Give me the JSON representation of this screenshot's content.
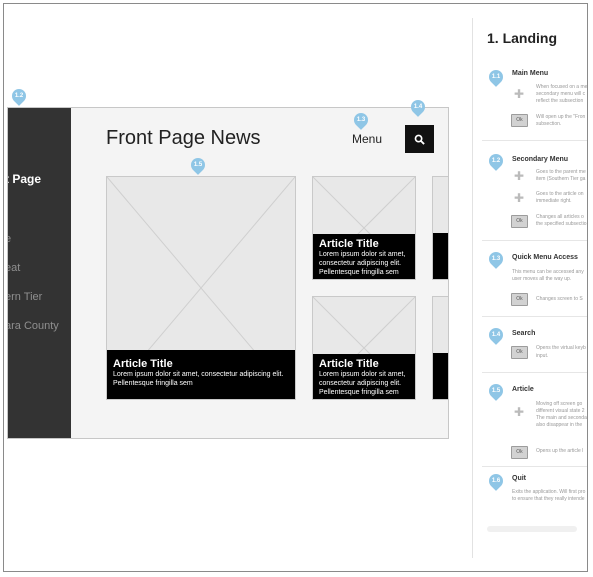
{
  "screen": {
    "title": "Front Page News",
    "menu_label": "Menu",
    "sidebar_items": [
      "t Page",
      "",
      "e",
      "eat",
      "ern Tier",
      "ara County"
    ],
    "articles": [
      {
        "title": "Article Title",
        "body1": "Lorem ipsum dolor sit amet, consectetur adipiscing elit.",
        "body2": "Pellentesque fringilla sem"
      },
      {
        "title": "Article Title",
        "body1": "Lorem ipsum dolor sit amet,",
        "body2": "consectetur adipiscing elit.",
        "body3": "Pellentesque fringilla sem"
      },
      {
        "title": "Article Title",
        "body1": "Lorem ipsum dolor sit amet,",
        "body2": "consectetur adipiscing elit.",
        "body3": "Pellentesque fringilla sem"
      }
    ]
  },
  "pins": {
    "p12": "1.2",
    "p13": "1.3",
    "p14": "1.4",
    "p15": "1.5"
  },
  "panel": {
    "title": "1. Landing",
    "sections": [
      {
        "num": "1.1",
        "title": "Main Menu",
        "lines": [
          "When focused on a me",
          "secondary menu will c",
          "reflect the subsection"
        ],
        "ok": "Ok",
        "ok_lines": [
          "Will open up the \"Fron",
          "subsection."
        ]
      },
      {
        "num": "1.2",
        "title": "Secondary Menu",
        "lines_a": [
          "Goes to the parent me",
          "item (Southern Tier ga"
        ],
        "lines_b": [
          "Goes to the article on",
          "immediate right."
        ],
        "ok": "Ok",
        "ok_lines": [
          "Changes all articles o",
          "the specified subsectio"
        ]
      },
      {
        "num": "1.3",
        "title": "Quick Menu Access",
        "lines": [
          "This menu can be accessed any",
          "user moves all the way up."
        ],
        "ok": "Ok",
        "ok_lines": [
          "Changes screen to S"
        ]
      },
      {
        "num": "1.4",
        "title": "Search",
        "ok": "Ok",
        "ok_lines": [
          "Opens the virtual keyb",
          "input."
        ]
      },
      {
        "num": "1.5",
        "title": "Article",
        "lines": [
          "Moving off screen go",
          "different visual state 2",
          "The main and seconda",
          "also disappear in the"
        ],
        "ok": "Ok",
        "ok_lines": [
          "Opens up the article l"
        ]
      },
      {
        "num": "1.6",
        "title": "Quit",
        "lines": [
          "Exits the application. Will first pro",
          "to ensure that they really intende"
        ]
      }
    ]
  },
  "colors": {
    "pin": "#8fc6e6",
    "sidebar": "#333333",
    "caption": "#000000"
  }
}
